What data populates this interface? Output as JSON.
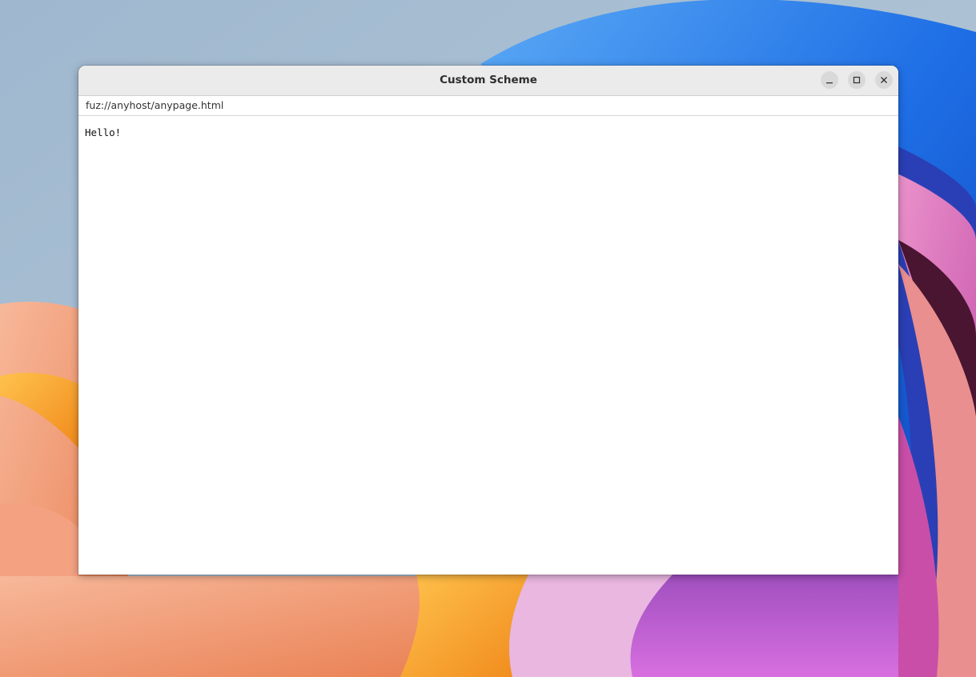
{
  "window": {
    "title": "Custom Scheme",
    "controls": {
      "minimize_icon": "minimize-icon",
      "maximize_icon": "maximize-icon",
      "close_icon": "close-icon"
    }
  },
  "address_bar": {
    "value": "fuz://anyhost/anypage.html"
  },
  "page": {
    "text": "Hello!"
  },
  "colors": {
    "titlebar": "#ebebeb",
    "window_button": "#d9d9d9",
    "content_background": "#ffffff"
  }
}
